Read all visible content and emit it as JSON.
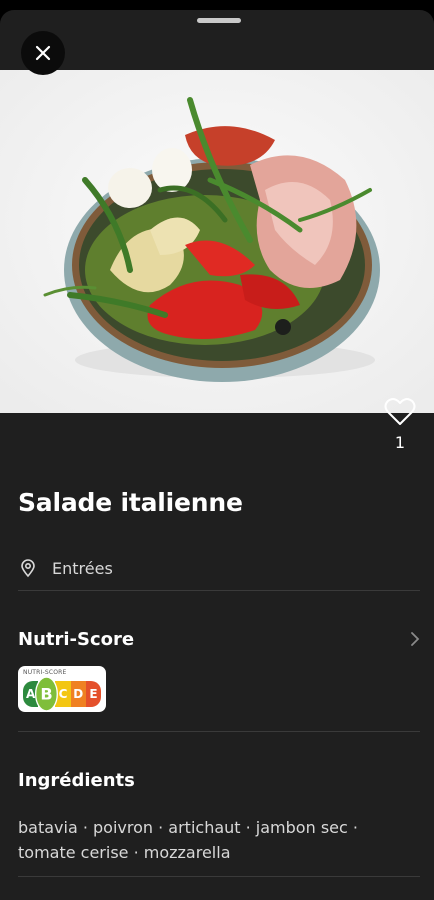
{
  "recipe": {
    "title": "Salade italienne",
    "category": "Entrées",
    "likes": "1"
  },
  "nutri_score": {
    "title": "Nutri-Score",
    "badge_label": "NUTRI-SCORE",
    "grades": [
      "A",
      "B",
      "C",
      "D",
      "E"
    ],
    "active_grade": "B",
    "grade_colors": [
      "#2d8a3e",
      "#7fbe3a",
      "#f3c613",
      "#ef8122",
      "#e4502b"
    ]
  },
  "ingredients": {
    "title": "Ingrédients",
    "list": "batavia · poivron · artichaut · jambon sec · tomate cerise · mozzarella"
  }
}
